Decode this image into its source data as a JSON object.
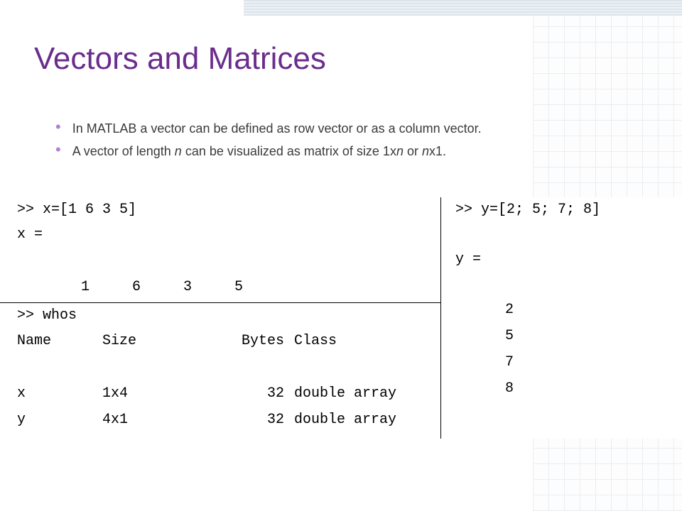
{
  "title": "Vectors and Matrices",
  "bullets": {
    "b1_pre": "In MATLAB a vector can be defined as row vector or as a column vector.",
    "b2_a": "A vector of length ",
    "b2_n1": "n",
    "b2_b": " can be visualized as matrix of size 1x",
    "b2_n2": "n",
    "b2_c": " or ",
    "b2_n3": "n",
    "b2_d": "x1."
  },
  "code": {
    "x_input": ">> x=[1 6 3 5]",
    "x_echo": "x =",
    "x_vals": "     1     6     3     5",
    "whos_cmd": ">> whos",
    "headers": {
      "name": "Name",
      "size": "Size",
      "bytes": "Bytes",
      "class": "Class"
    },
    "rows": [
      {
        "name": "x",
        "size": "1x4",
        "bytes": "32",
        "class": "double array"
      },
      {
        "name": "y",
        "size": "4x1",
        "bytes": "32",
        "class": "double array"
      }
    ],
    "y_input": ">> y=[2; 5; 7; 8]",
    "y_echo": "y =",
    "y_vals": [
      "2",
      "5",
      "7",
      "8"
    ]
  }
}
